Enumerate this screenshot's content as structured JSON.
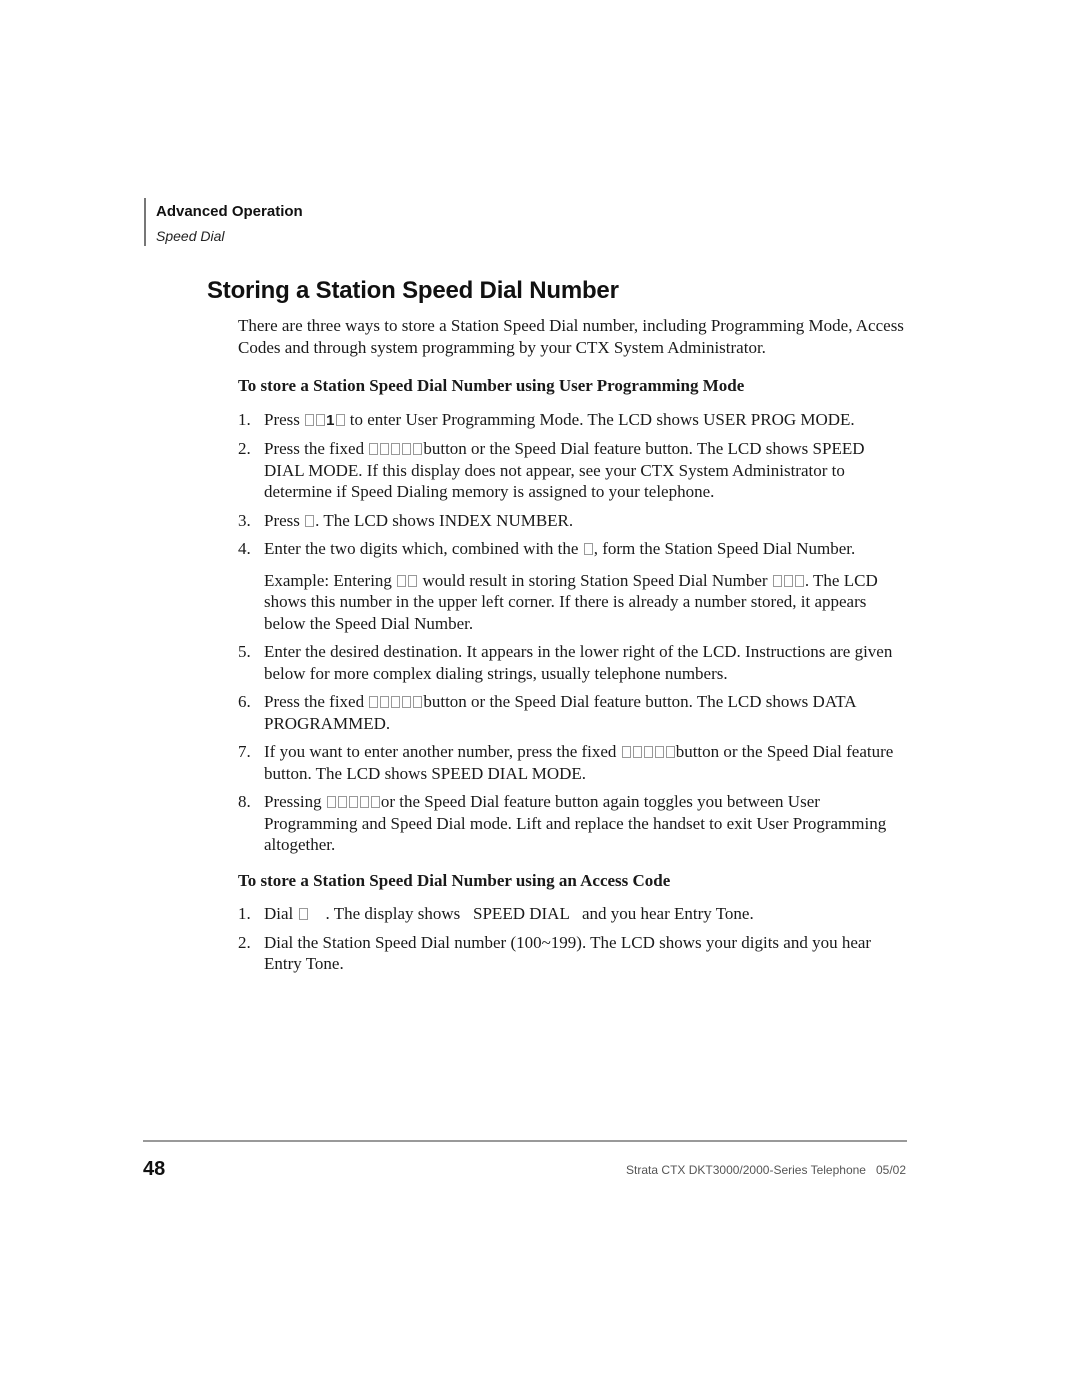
{
  "header": {
    "section": "Advanced Operation",
    "subsection": "Speed Dial"
  },
  "title": "Storing a Station Speed Dial Number",
  "intro": "There are three ways to store a Station Speed Dial number, including Programming Mode, Access Codes and through system programming by your CTX System Administrator.",
  "procedure_user_prog": {
    "heading": "To store a Station Speed Dial Number using User Programming Mode",
    "steps": [
      {
        "num": "1.",
        "before": "Press ",
        "key": "1",
        "after": "  to enter User Programming Mode. The LCD shows   USER PROG MODE."
      },
      {
        "num": "2.",
        "before": "Press the fixed ",
        "after": "button or the Speed Dial feature button. The LCD shows   SPEED DIAL MODE.   If this display does not appear, see your CTX System Administrator to determine if Speed Dialing memory is assigned to your telephone."
      },
      {
        "num": "3.",
        "before": "Press ",
        "after": ". The LCD shows   INDEX NUMBER."
      },
      {
        "num": "4.",
        "before": "Enter the two digits which, combined with the ",
        "after": ", form the Station Speed Dial Number.",
        "example_before": "Example: Entering ",
        "example_mid": " would result in storing Station Speed Dial Number ",
        "example_after": ". The LCD shows this number in the upper left corner. If there is already a number stored, it appears below the Speed Dial Number."
      },
      {
        "num": "5.",
        "text": "Enter the desired destination. It appears in the lower right of the LCD. Instructions are given below for more complex dialing strings, usually telephone numbers."
      },
      {
        "num": "6.",
        "before": "Press the fixed ",
        "after": "button or the Speed Dial feature button. The LCD shows   DATA PROGRAMMED."
      },
      {
        "num": "7.",
        "before": "If you want to enter another number, press the fixed ",
        "after": "button or the Speed Dial feature button. The LCD shows   SPEED DIAL MODE."
      },
      {
        "num": "8.",
        "before": "Pressing ",
        "after": "or the Speed Dial feature button again toggles you between User Programming and Speed Dial mode. Lift and replace the handset to exit User Programming altogether."
      }
    ]
  },
  "procedure_access_code": {
    "heading": "To store a Station Speed Dial Number using an Access Code",
    "steps": [
      {
        "num": "1.",
        "before": "Dial ",
        "after": "    . The display shows   SPEED DIAL   and you hear Entry Tone."
      },
      {
        "num": "2.",
        "text": "Dial the Station Speed Dial number (100~199). The LCD shows your digits and you hear Entry Tone."
      }
    ]
  },
  "footer": {
    "page_number": "48",
    "document": "Strata CTX DKT3000/2000-Series Telephone   05/02"
  }
}
